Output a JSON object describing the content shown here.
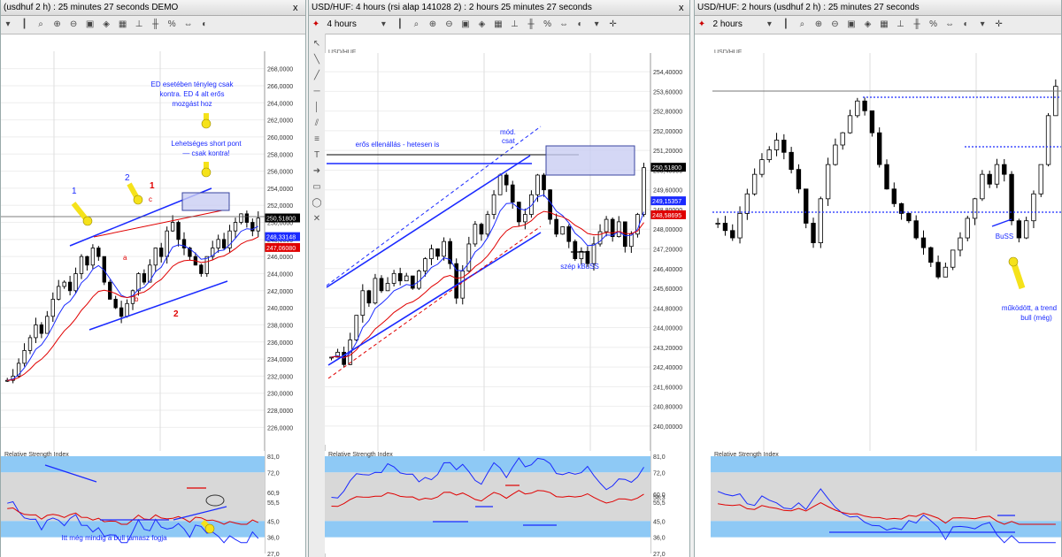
{
  "panels": [
    {
      "title": "(usdhuf 2 h) : 25 minutes 27 seconds DEMO",
      "close": "x",
      "price_axis": [
        "268,0000",
        "266,0000",
        "264,0000",
        "262,0000",
        "260,0000",
        "258,0000",
        "256,0000",
        "254,0000",
        "252,0000",
        "250,0000",
        "248,0000",
        "246,0000",
        "244,0000",
        "242,0000",
        "240,0000",
        "238,0000",
        "236,0000",
        "234,0000",
        "232,0000",
        "230,0000",
        "228,0000",
        "226,0000"
      ],
      "price_tags": [
        {
          "text": "250,51800",
          "color": "#000000"
        },
        {
          "text": "248,33148",
          "color": "#1a2aff"
        },
        {
          "text": "247,06080",
          "color": "#e00000"
        }
      ],
      "rsi_title": "Relative Strength Index",
      "rsi_axis": [
        "81,0",
        "72,0",
        "60,9",
        "55,5",
        "45,0",
        "36,0",
        "27,0"
      ],
      "annotations": [
        "ED esetében tényleg csak",
        "kontra. ED 4 alt erős",
        "mozgást hoz",
        "Lehetséges short pont",
        "— csak kontra!",
        "1",
        "2",
        "1",
        "2",
        "c",
        "a",
        "b",
        "Itt még mindig a bull támasz fogja"
      ]
    },
    {
      "title": "USD/HUF: 4 hours (rsi alap 141028 2) : 2 hours 25 minutes 27 seconds",
      "timeframe": "4 hours",
      "symbol": "USD/HUF",
      "close": "x",
      "price_axis": [
        "254,40000",
        "253,60000",
        "252,80000",
        "252,00000",
        "251,20000",
        "250,40000",
        "249,60000",
        "248,80000",
        "248,00000",
        "247,20000",
        "246,40000",
        "245,60000",
        "244,80000",
        "244,00000",
        "243,20000",
        "242,40000",
        "241,60000",
        "240,80000",
        "240,00000"
      ],
      "price_tags": [
        {
          "text": "250,51800",
          "color": "#000000"
        },
        {
          "text": "249,15357",
          "color": "#1a2aff"
        },
        {
          "text": "248,58695",
          "color": "#e00000"
        }
      ],
      "rsi_title": "Relative Strength Index",
      "rsi_axis": [
        "81,0",
        "72,0",
        "60,0",
        "58,3",
        "55,5",
        "45,0",
        "36,0",
        "27,0"
      ],
      "annotations": [
        "erős ellenállás - hetesen is",
        "mód.",
        "csat",
        "szép kBuSS"
      ]
    },
    {
      "title": "USD/HUF: 2 hours (usdhuf 2 h) : 25 minutes 27 seconds",
      "timeframe": "2 hours",
      "symbol": "USD/HUF",
      "rsi_title": "Relative Strength Index",
      "annotations": [
        "BuSS",
        "működött, a trend",
        "bull (még)"
      ]
    }
  ],
  "chart_data": [
    {
      "type": "candlestick",
      "title": "",
      "timeframe": "2 hours",
      "ylim": [
        225,
        269
      ],
      "last_price": 250.518,
      "ema_fast": 248.33148,
      "ema_slow": 247.0608,
      "closes": [
        231.5,
        232,
        233.5,
        235,
        236.5,
        238,
        237,
        239,
        241,
        242.5,
        243,
        242,
        244,
        246,
        245,
        247,
        246,
        243,
        241,
        240,
        239,
        240.5,
        242,
        244,
        243,
        245,
        247,
        246,
        249,
        250,
        248,
        247,
        246,
        245,
        244,
        246,
        247,
        248,
        247,
        249,
        250,
        251,
        250,
        249,
        250.5
      ],
      "rsi": {
        "ylim": [
          27,
          81
        ],
        "levels": [
          81,
          72,
          45,
          36,
          27
        ],
        "last": [
          60.9,
          55.5
        ]
      }
    },
    {
      "type": "candlestick",
      "title": "",
      "timeframe": "4 hours",
      "symbol": "USD/HUF",
      "ylim": [
        239.6,
        254.8
      ],
      "last_price": 250.518,
      "ema_fast": 249.15357,
      "ema_slow": 248.58695,
      "closes": [
        242.8,
        243,
        242.5,
        243.5,
        244.5,
        245.5,
        245,
        246,
        245.5,
        245.8,
        246.2,
        245.9,
        246.1,
        245.6,
        246.3,
        246.8,
        247.2,
        246.9,
        247.5,
        246.6,
        245.2,
        246.3,
        247.4,
        248.2,
        247.8,
        248.6,
        249.4,
        250.2,
        249.8,
        249.1,
        248.3,
        248.6,
        249.4,
        250.2,
        249.6,
        248.4,
        247.8,
        248.1,
        247.5,
        246.8,
        247.1,
        246.6,
        247.4,
        247.9,
        248.4,
        247.7,
        248.3,
        247.3,
        247.8,
        248.6,
        250.5
      ],
      "rsi": {
        "ylim": [
          27,
          81
        ],
        "levels": [
          81,
          72,
          45,
          36,
          27
        ],
        "last": [
          60.0,
          58.3,
          55.5
        ]
      }
    },
    {
      "type": "candlestick",
      "title": "",
      "timeframe": "2 hours",
      "symbol": "USD/HUF",
      "ylim": [
        239.5,
        254.8
      ],
      "last_price": 253.6,
      "closes": [
        248.2,
        247.9,
        247.6,
        248.6,
        249.4,
        250.2,
        250.8,
        251.2,
        251.6,
        251.1,
        250.4,
        249.6,
        248.2,
        247.4,
        249.2,
        250.6,
        251.4,
        251.9,
        252.6,
        253.2,
        252.8,
        251.9,
        250.6,
        249.6,
        249.0,
        248.6,
        248.3,
        247.6,
        247.2,
        246.6,
        246.0,
        246.4,
        247.1,
        247.6,
        248.4,
        249.2,
        250.2,
        249.8,
        250.6,
        250.2,
        248.3,
        247.6,
        248.3,
        249.4,
        250.6,
        252.6,
        253.8
      ],
      "rsi": {
        "ylim": [
          27,
          81
        ],
        "levels": [
          81,
          72,
          45,
          36,
          27
        ]
      }
    }
  ],
  "colors": {
    "candle": "#000000",
    "ema_fast": "#1a2aff",
    "ema_slow": "#e00000",
    "rsi_band": "#8ec9f5",
    "rsi_mid": "#d8d8d8",
    "annotation_blue": "#1a2aff",
    "annotation_red": "#e00000",
    "arrow_yellow": "#f5e21a"
  }
}
